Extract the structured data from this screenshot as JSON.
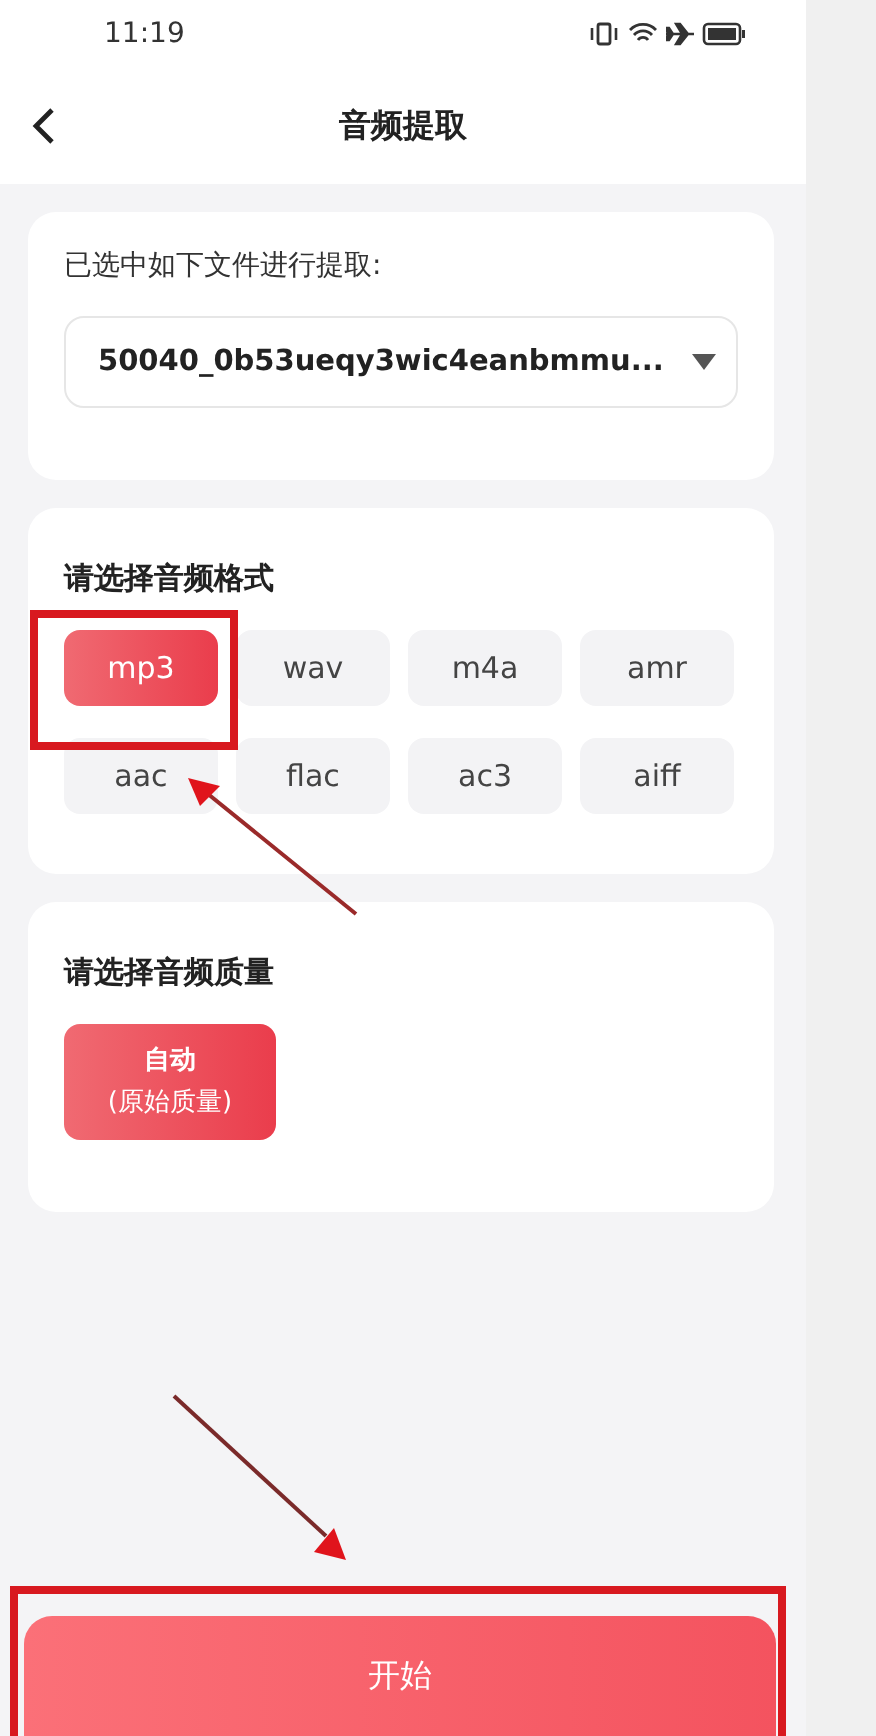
{
  "status_bar": {
    "time": "11:19"
  },
  "header": {
    "title": "音频提取"
  },
  "file_section": {
    "label": "已选中如下文件进行提取:",
    "selected_file": "50040_0b53ueqy3wic4eanbmmu..."
  },
  "format_section": {
    "title": "请选择音频格式",
    "formats": [
      {
        "label": "mp3",
        "selected": true
      },
      {
        "label": "wav",
        "selected": false
      },
      {
        "label": "m4a",
        "selected": false
      },
      {
        "label": "amr",
        "selected": false
      },
      {
        "label": "aac",
        "selected": false
      },
      {
        "label": "flac",
        "selected": false
      },
      {
        "label": "ac3",
        "selected": false
      },
      {
        "label": "aiff",
        "selected": false
      }
    ]
  },
  "quality_section": {
    "title": "请选择音频质量",
    "options": [
      {
        "label": "自动",
        "sublabel": "(原始质量)",
        "selected": true
      }
    ]
  },
  "start_button": {
    "label": "开始"
  }
}
